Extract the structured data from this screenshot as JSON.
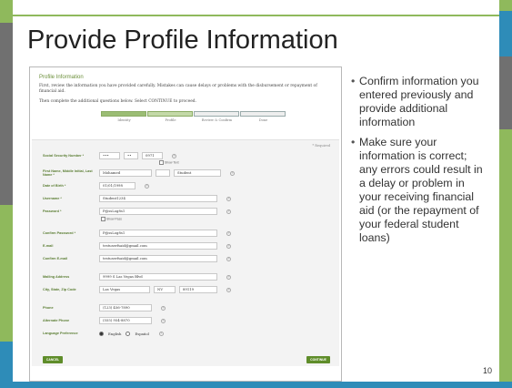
{
  "colors": {
    "green_dark": "#5a8a32",
    "green_light": "#8fb95c",
    "blue": "#2e8cb8",
    "gray": "#707070",
    "light_gray": "#d9d9d9"
  },
  "slide": {
    "title": "Provide Profile Information",
    "number": "10",
    "bullets": [
      "Confirm information you entered previously and provide additional information",
      "Make sure your information is correct; any errors could result in a delay or problem in your receiving financial aid (or the repayment of your federal student loans)"
    ]
  },
  "screenshot": {
    "title": "Profile Information",
    "intro": "First, review the information you have provided carefully. Mistakes can cause delays or problems with the disbursement or repayment of financial aid.",
    "intro2": "Then complete the additional questions below. Select CONTINUE to proceed.",
    "progress_steps": [
      "Identity",
      "Profile",
      "Review & Confirm",
      "Done"
    ],
    "required_note": "* Required",
    "fields": {
      "ssn_label": "Social Security Number *",
      "ssn_1": "•••",
      "ssn_2": "••",
      "ssn_3": "0971",
      "ssn_show": "Show Text",
      "name_label": "First Name, Middle Initial, Last Name *",
      "first_name": "Mohamed",
      "last_name": "Student",
      "dob_label": "Date of Birth *",
      "dob": "01/01/1998",
      "username_label": "Username *",
      "username": "Student1234",
      "password_label": "Password *",
      "password": "P@ssLog8s1",
      "show_pass": "Show Pass",
      "confirm_password_label": "Confirm Password *",
      "confirm_password": "P@ssLog8s1",
      "email_label": "E-mail",
      "email": "testuserfsaid@gmail.com",
      "confirm_email_label": "Confirm E-mail",
      "confirm_email": "testuserfsaid@gmail.com",
      "mailing_label": "Mailing Address",
      "mailing": "9999 S Las Vegas Blvd",
      "csz_label": "City, State, Zip Code",
      "city": "Las Vegas",
      "state": "NV",
      "zip": "89119",
      "phone_label": "Phone",
      "phone": "(123) 456-7890",
      "alt_phone_label": "Alternate Phone",
      "alt_phone": "(555) 954-8870",
      "lang_label": "Language Preference",
      "lang_en": "English",
      "lang_es": "Español"
    },
    "cancel_button": "CANCEL",
    "continue_button": "CONTINUE"
  }
}
